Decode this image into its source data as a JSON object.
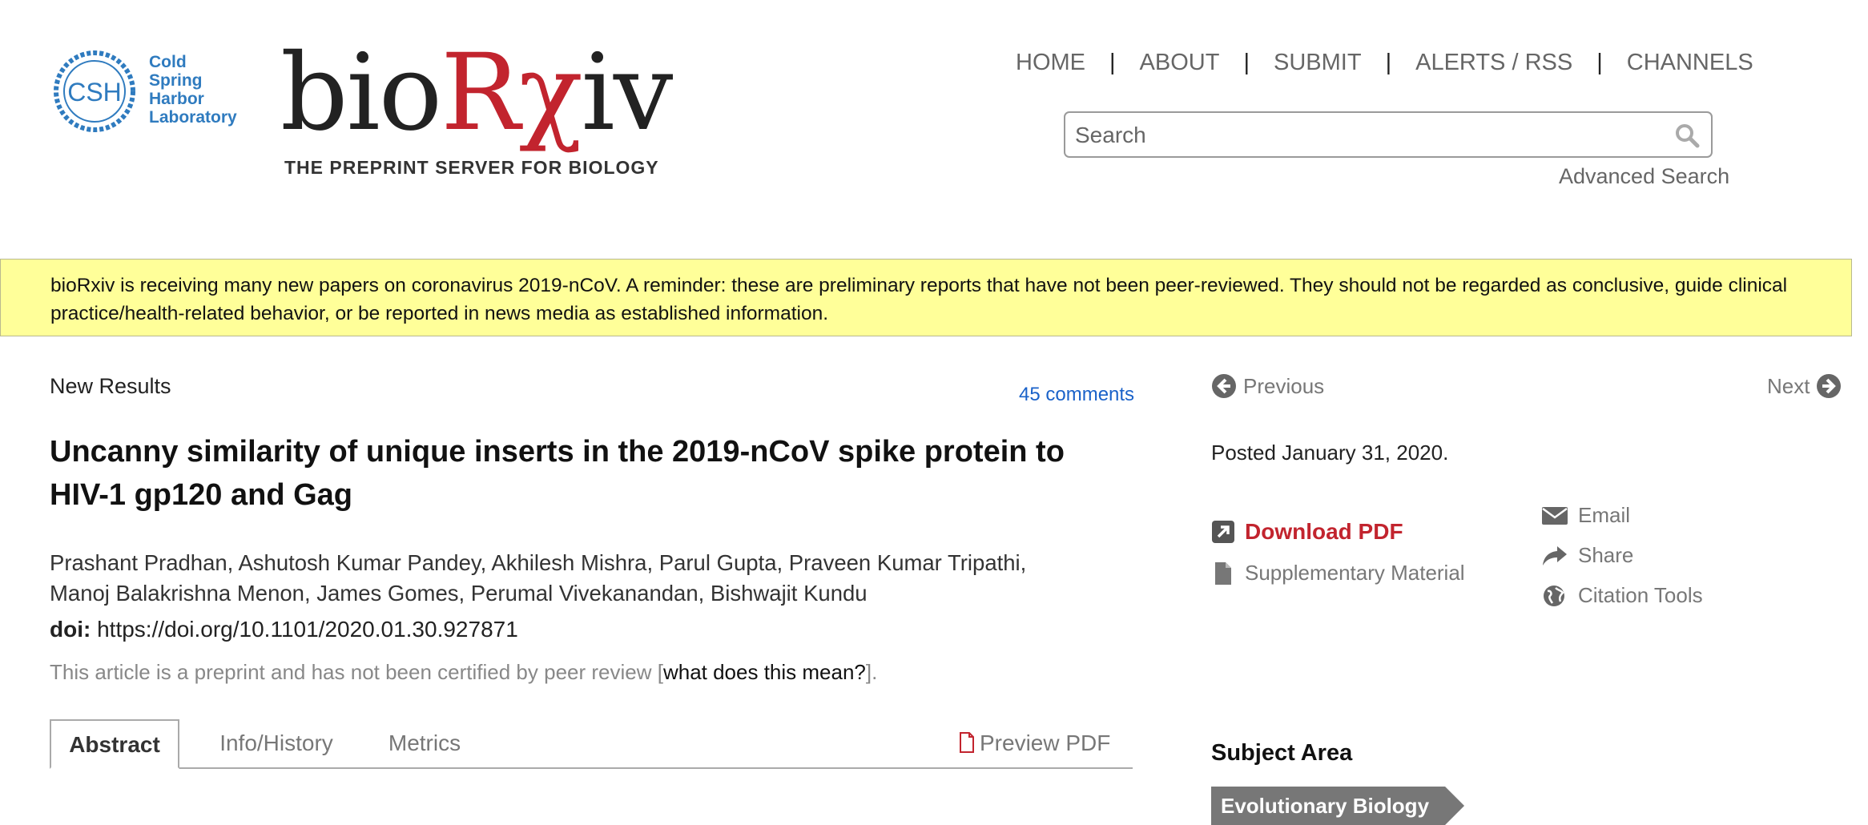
{
  "header": {
    "csh_logo": {
      "abbrev": "CSH",
      "lines": [
        "Cold",
        "Spring",
        "Harbor",
        "Laboratory"
      ]
    },
    "wordmark": {
      "part1": "bio",
      "part2": "Rχ",
      "part3": "iv"
    },
    "tagline": "THE PREPRINT SERVER FOR BIOLOGY",
    "nav": [
      "HOME",
      "ABOUT",
      "SUBMIT",
      "ALERTS / RSS",
      "CHANNELS"
    ],
    "nav_separator": "|",
    "search": {
      "placeholder": "Search",
      "value": ""
    },
    "advanced_search": "Advanced Search"
  },
  "banner": {
    "text": "bioRxiv is receiving many new papers on coronavirus 2019-nCoV.   A reminder: these are preliminary reports that have not been peer-reviewed. They should not be regarded as conclusive, guide clinical practice/health-related behavior, or be reported in news media as established information."
  },
  "article": {
    "type": "New Results",
    "comments": "45 comments",
    "title": "Uncanny similarity of unique inserts in the 2019-nCoV spike protein to HIV-1 gp120 and Gag",
    "authors_line1": "Prashant Pradhan, Ashutosh Kumar Pandey, Akhilesh Mishra, Parul Gupta, Praveen Kumar Tripathi,",
    "authors_line2": "Manoj Balakrishna Menon, James Gomes, Perumal Vivekanandan, Bishwajit Kundu",
    "doi_label": "doi:",
    "doi_value": "https://doi.org/10.1101/2020.01.30.927871",
    "preprint_note_before": "This article is a preprint and has not been certified by peer review [",
    "preprint_note_link": "what does this mean?",
    "preprint_note_after": "]."
  },
  "tabs": {
    "abstract": "Abstract",
    "info": "Info/History",
    "metrics": "Metrics",
    "preview_pdf": "Preview PDF"
  },
  "sidebar": {
    "previous": "Previous",
    "next": "Next",
    "posted": "Posted January 31, 2020.",
    "download_pdf": "Download PDF",
    "supplementary": "Supplementary Material",
    "email": "Email",
    "share": "Share",
    "citation_tools": "Citation Tools",
    "subject_heading": "Subject Area",
    "subject_tag": "Evolutionary Biology"
  },
  "colors": {
    "brand_red": "#c2242e",
    "csh_blue": "#2f7bbf",
    "link_blue": "#1a62c9",
    "banner_yellow": "#ffff99",
    "tag_gray": "#777777"
  }
}
